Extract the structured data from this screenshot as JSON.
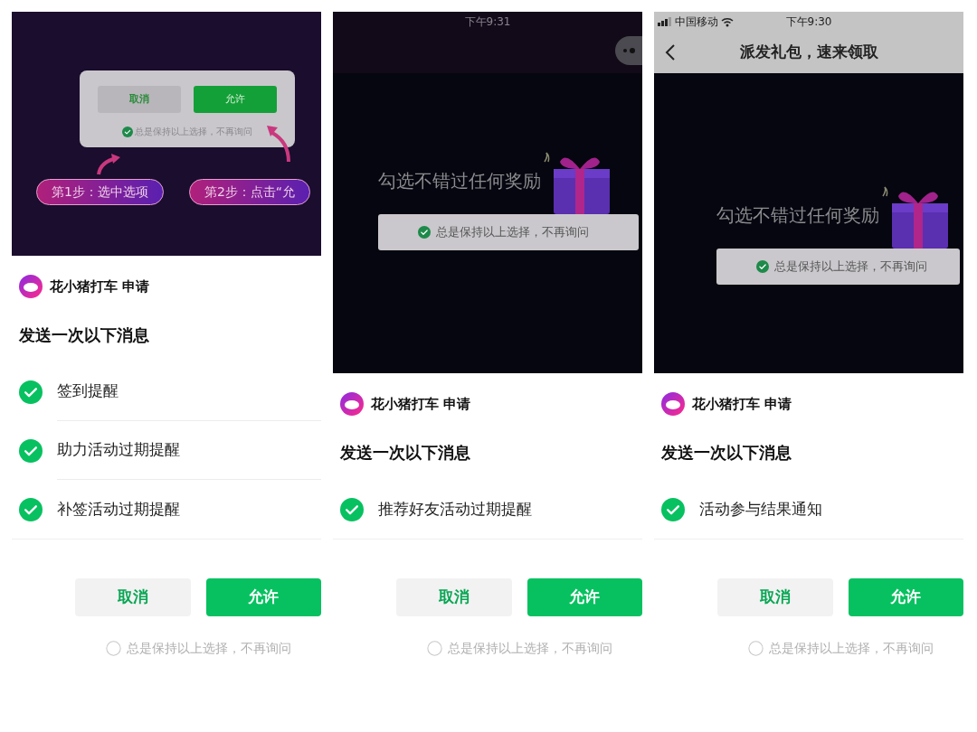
{
  "panels": [
    {
      "preview": {
        "kind": "tutorial",
        "dialog": {
          "cancel": "取消",
          "allow": "允许",
          "remember": {
            "label": "总是保持以上选择，不再询问",
            "checked": true
          }
        },
        "steps": [
          "第1步：选中选项",
          "第2步：点击“允"
        ]
      },
      "sheet": {
        "app_name": "花小猪打车 申请",
        "title": "发送一次以下消息",
        "items": [
          {
            "label": "签到提醒",
            "checked": true
          },
          {
            "label": "助力活动过期提醒",
            "checked": true
          },
          {
            "label": "补签活动过期提醒",
            "checked": true
          }
        ],
        "cancel": "取消",
        "allow": "允许",
        "remember": {
          "label": "总是保持以上选择，不再询问",
          "checked": false
        }
      }
    },
    {
      "preview": {
        "kind": "page",
        "status_bar": {
          "time": "下午9:31"
        },
        "capsule": true,
        "headline": "勾选不错过任何奖励",
        "remember": {
          "label": "总是保持以上选择，不再询问",
          "checked": true
        }
      },
      "sheet": {
        "app_name": "花小猪打车 申请",
        "title": "发送一次以下消息",
        "items": [
          {
            "label": "推荐好友活动过期提醒",
            "checked": true
          }
        ],
        "cancel": "取消",
        "allow": "允许",
        "remember": {
          "label": "总是保持以上选择，不再询问",
          "checked": false
        }
      }
    },
    {
      "preview": {
        "kind": "page",
        "status_bar": {
          "carrier": "中国移动",
          "time": "下午9:30"
        },
        "nav_title": "派发礼包，速来领取",
        "headline": "勾选不错过任何奖励",
        "remember": {
          "label": "总是保持以上选择，不再询问",
          "checked": true
        }
      },
      "sheet": {
        "app_name": "花小猪打车 申请",
        "title": "发送一次以下消息",
        "items": [
          {
            "label": "活动参与结果通知",
            "checked": true
          }
        ],
        "cancel": "取消",
        "allow": "允许",
        "remember": {
          "label": "总是保持以上选择，不再询问",
          "checked": false
        }
      }
    }
  ]
}
